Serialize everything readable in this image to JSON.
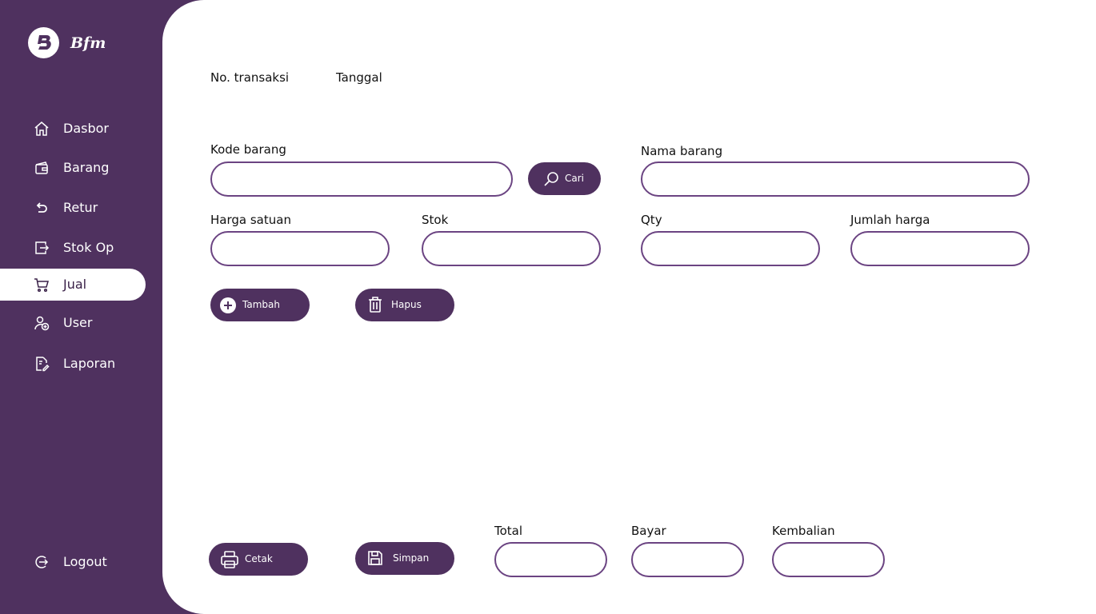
{
  "brand": {
    "name": "Bfm"
  },
  "sidebar": {
    "items": [
      {
        "label": "Dasbor",
        "icon": "home-icon"
      },
      {
        "label": "Barang",
        "icon": "box-icon"
      },
      {
        "label": "Retur",
        "icon": "return-icon"
      },
      {
        "label": "Stok Op",
        "icon": "stock-opname-icon"
      },
      {
        "label": "Jual",
        "icon": "cart-icon",
        "active": true
      },
      {
        "label": "User",
        "icon": "user-add-icon"
      },
      {
        "label": "Laporan",
        "icon": "report-icon"
      }
    ],
    "logout": {
      "label": "Logout",
      "icon": "logout-icon"
    }
  },
  "header": {
    "no_transaksi_label": "No. transaksi",
    "tanggal_label": "Tanggal"
  },
  "form": {
    "kode_barang": {
      "label": "Kode barang",
      "value": ""
    },
    "cari_button": "Cari",
    "nama_barang": {
      "label": "Nama barang",
      "value": ""
    },
    "harga_satuan": {
      "label": "Harga satuan",
      "value": ""
    },
    "stok": {
      "label": "Stok",
      "value": ""
    },
    "qty": {
      "label": "Qty",
      "value": ""
    },
    "jumlah_harga": {
      "label": "Jumlah harga",
      "value": ""
    }
  },
  "actions": {
    "tambah": "Tambah",
    "hapus": "Hapus",
    "cetak": "Cetak",
    "simpan": "Simpan"
  },
  "summary": {
    "total": {
      "label": "Total",
      "value": ""
    },
    "bayar": {
      "label": "Bayar",
      "value": ""
    },
    "kembalian": {
      "label": "Kembalian",
      "value": ""
    }
  },
  "colors": {
    "primary": "#4f315f",
    "field_border": "#6b4482",
    "background": "#ffffff"
  }
}
